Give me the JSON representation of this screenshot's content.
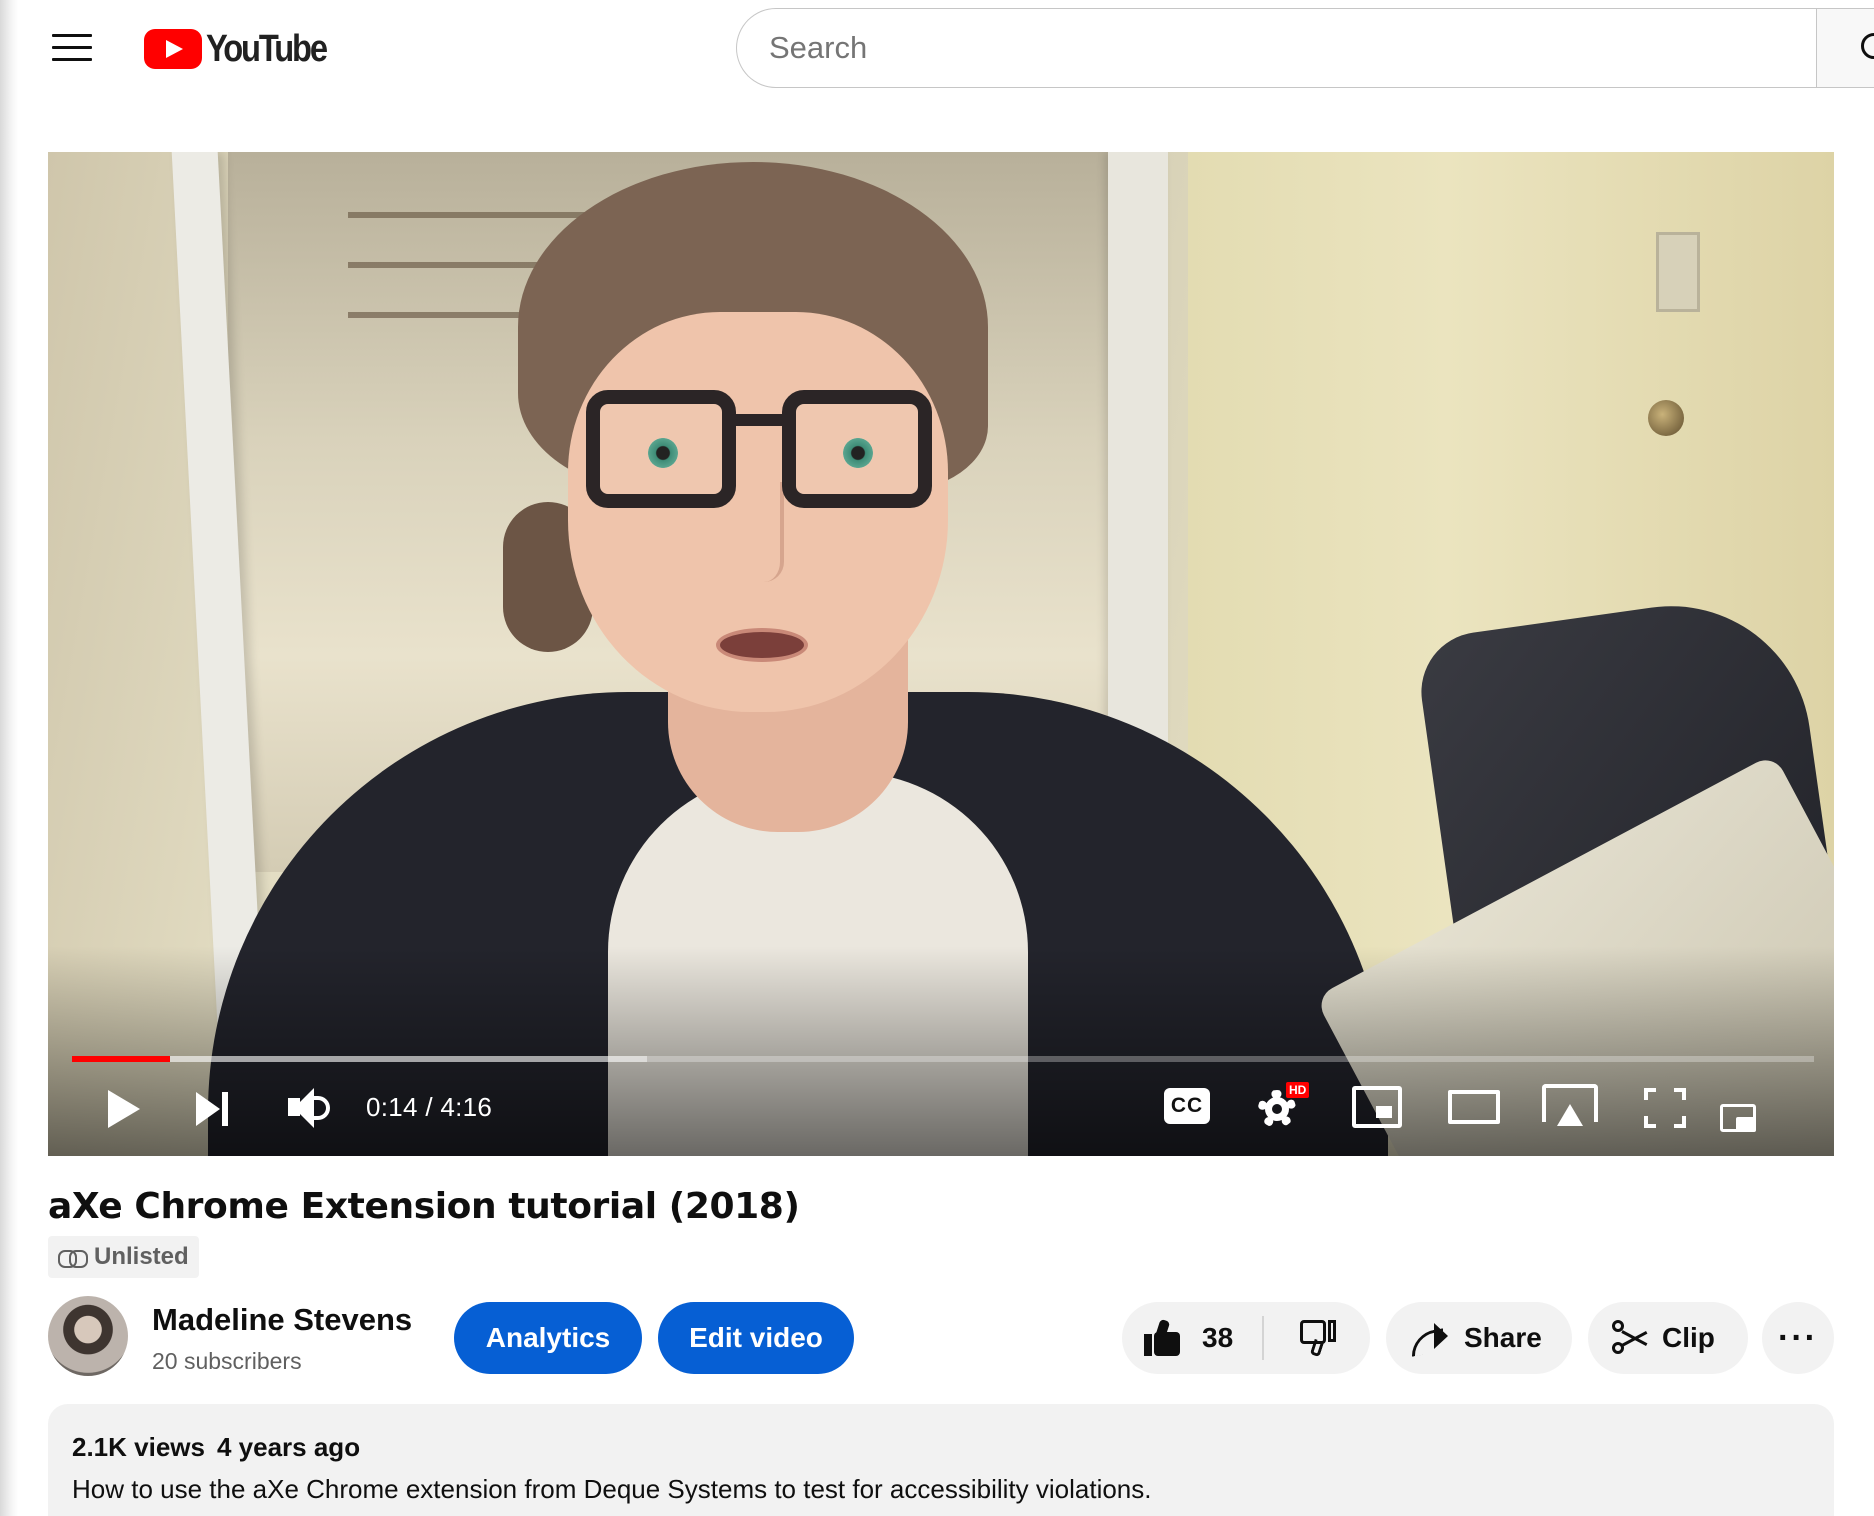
{
  "header": {
    "logo_text": "YouTube",
    "search_placeholder": "Search"
  },
  "player": {
    "current_time": "0:14",
    "duration": "4:16",
    "time_display": "0:14 / 4:16",
    "progress_played_fraction": 0.056,
    "progress_buffered_fraction": 0.33,
    "cc_label": "CC",
    "quality_badge": "HD"
  },
  "video": {
    "title": "aXe Chrome Extension tutorial (2018)",
    "visibility": "Unlisted"
  },
  "channel": {
    "name": "Madeline Stevens",
    "subscribers": "20 subscribers"
  },
  "actions": {
    "analytics_label": "Analytics",
    "edit_label": "Edit video",
    "like_count": "38",
    "share_label": "Share",
    "clip_label": "Clip",
    "more_label": "···"
  },
  "description": {
    "views": "2.1K views",
    "age": "4 years ago",
    "text": "How to use the aXe Chrome extension from Deque Systems to test for accessibility violations."
  },
  "colors": {
    "brand_red": "#ff0000",
    "primary_blue": "#065fd4",
    "chip_grey": "#f2f2f2"
  }
}
